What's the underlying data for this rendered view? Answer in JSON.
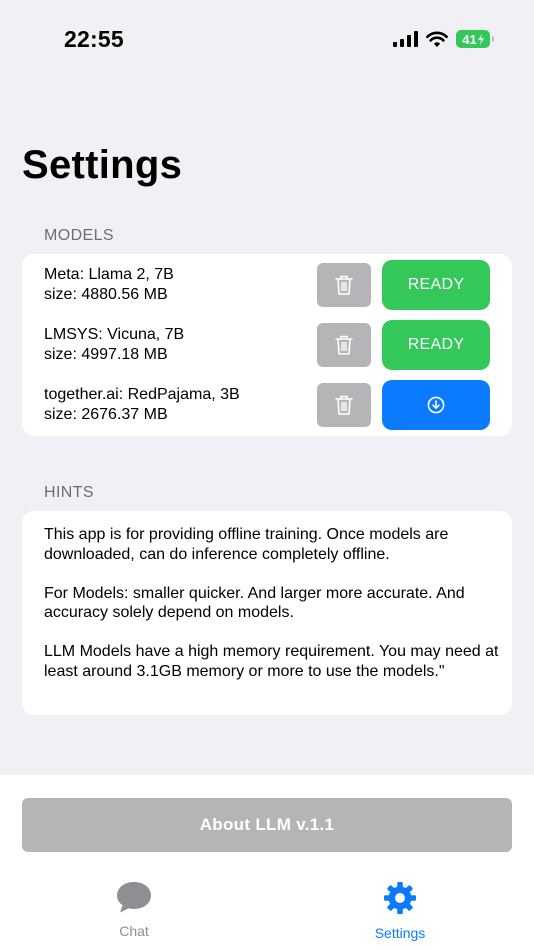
{
  "status_bar": {
    "time": "22:55",
    "battery": "41"
  },
  "page": {
    "title": "Settings"
  },
  "models": {
    "header": "MODELS",
    "items": [
      {
        "name": "Meta: Llama 2, 7B",
        "size": "size: 4880.56 MB",
        "status": "READY",
        "state": "ready"
      },
      {
        "name": "LMSYS: Vicuna, 7B",
        "size": "size: 4997.18 MB",
        "status": "READY",
        "state": "ready"
      },
      {
        "name": "together.ai: RedPajama, 3B",
        "size": "size: 2676.37 MB",
        "status": "",
        "state": "download"
      }
    ]
  },
  "hints": {
    "header": "HINTS",
    "paragraphs": [
      "This app is for providing offline training.  Once models are downloaded, can do inference completely offline.",
      "For Models: smaller quicker.  And larger more accurate.  And accuracy solely depend on models.",
      "LLM Models have a high memory requirement.  You may need at least around 3.1GB memory or more to use the models.\""
    ]
  },
  "about_button": {
    "label": "About LLM v.1.1"
  },
  "tab_bar": {
    "tabs": [
      {
        "label": "Chat",
        "icon": "chat-bubble-icon",
        "active": false
      },
      {
        "label": "Settings",
        "icon": "gear-icon",
        "active": true
      }
    ]
  },
  "colors": {
    "background": "#f1f1f5",
    "ready_green": "#34c759",
    "download_blue": "#0a7aff",
    "disabled_gray": "#b5b5b8",
    "active_tab": "#0a7aff",
    "inactive_tab": "#8e8e93"
  }
}
